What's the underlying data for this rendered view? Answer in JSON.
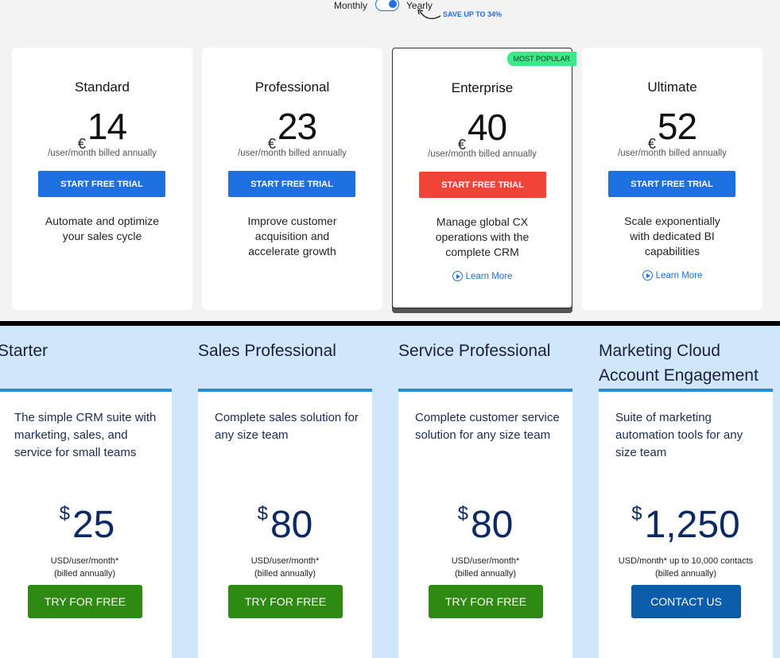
{
  "billing": {
    "monthly_label": "Monthly",
    "yearly_label": "Yearly",
    "selected": "Yearly",
    "save_note": "SAVE UP TO 34%"
  },
  "zoho_plans": [
    {
      "name": "Standard",
      "currency": "€",
      "price": "14",
      "period": "/user/month billed annually",
      "cta": "START FREE TRIAL",
      "description": "Automate and optimize your sales cycle"
    },
    {
      "name": "Professional",
      "currency": "€",
      "price": "23",
      "period": "/user/month billed annually",
      "cta": "START FREE TRIAL",
      "description": "Improve customer acquisition and accelerate growth"
    },
    {
      "name": "Enterprise",
      "badge": "MOST POPULAR",
      "currency": "€",
      "price": "40",
      "period": "/user/month billed annually",
      "cta": "START FREE TRIAL",
      "description": "Manage global CX operations with the complete CRM",
      "learn_more": "Learn More"
    },
    {
      "name": "Ultimate",
      "currency": "€",
      "price": "52",
      "period": "/user/month billed annually",
      "cta": "START FREE TRIAL",
      "description": "Scale exponentially with dedicated BI capabilities",
      "learn_more": "Learn More"
    }
  ],
  "salesforce_plans": [
    {
      "name": "Starter",
      "description": "The simple CRM suite with marketing, sales, and service for small teams",
      "currency": "$",
      "price": "25",
      "unit_line1": "USD/user/month*",
      "unit_line2": "(billed annually)",
      "cta": "TRY FOR FREE"
    },
    {
      "name": "Sales Professional",
      "description": "Complete sales solution for any size team",
      "currency": "$",
      "price": "80",
      "unit_line1": "USD/user/month*",
      "unit_line2": "(billed annually)",
      "cta": "TRY FOR FREE"
    },
    {
      "name": "Service Professional",
      "description": "Complete customer service solution for any size team",
      "currency": "$",
      "price": "80",
      "unit_line1": "USD/user/month*",
      "unit_line2": "(billed annually)",
      "cta": "TRY FOR FREE"
    },
    {
      "name_line1": "Marketing Cloud",
      "name_line2": "Account Engagement",
      "description": "Suite of marketing automation tools for any size team",
      "currency": "$",
      "price": "1,250",
      "unit_line1": "USD/month* up to 10,000 contacts",
      "unit_line2": "(billed annually)",
      "cta": "CONTACT US"
    }
  ],
  "colors": {
    "primary_blue": "#1e6fe0",
    "popular_red": "#f04438",
    "badge_green": "#3ee88a",
    "sf_green": "#2e8a12",
    "sf_blue": "#0b5cab",
    "sf_background": "#cfe6fb"
  }
}
